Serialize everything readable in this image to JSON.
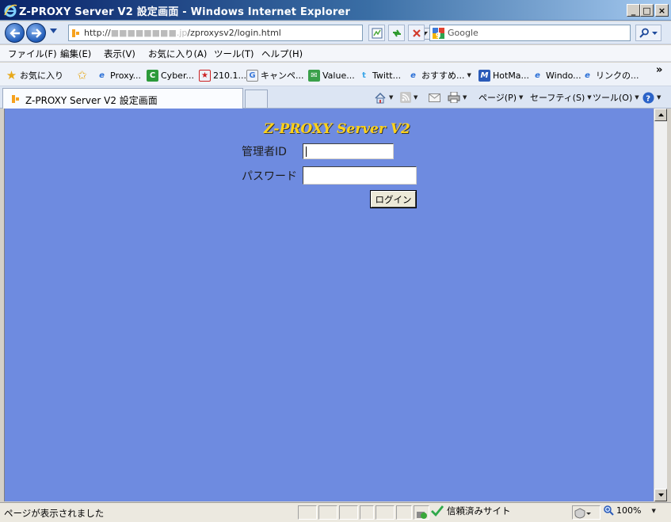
{
  "window": {
    "title": "Z-PROXY Server V2 設定画面 - Windows Internet Explorer",
    "controls": {
      "minimize": "_",
      "maximize": "□",
      "close": "×"
    }
  },
  "address_bar": {
    "url_prefix": "http://",
    "url_masked": "■■■■■■■■.jp",
    "url_path": "/zproxysv2/login.html"
  },
  "search": {
    "placeholder": "Google"
  },
  "menu": {
    "items": [
      "ファイル(F)",
      "編集(E)",
      "表示(V)",
      "お気に入り(A)",
      "ツール(T)",
      "ヘルプ(H)"
    ]
  },
  "favorites": {
    "label": "お気に入り",
    "items": [
      {
        "label": "Proxy..."
      },
      {
        "label": "Cyber..."
      },
      {
        "label": "210.1..."
      },
      {
        "label": "キャンペ..."
      },
      {
        "label": "Value..."
      },
      {
        "label": "Twitt..."
      },
      {
        "label": "おすすめ..."
      },
      {
        "label": "HotMa..."
      },
      {
        "label": "Windo..."
      },
      {
        "label": "リンクの..."
      }
    ],
    "more": "»"
  },
  "tab": {
    "label": "Z-PROXY Server V2 設定画面"
  },
  "command_bar": {
    "page": "ページ(P)",
    "safety": "セーフティ(S)",
    "tools": "ツール(O)"
  },
  "page": {
    "title": "Z-PROXY Server V2",
    "admin_id_label": "管理者ID",
    "admin_id_value": "",
    "password_label": "パスワード",
    "password_value": "",
    "login_button": "ログイン"
  },
  "status": {
    "text": "ページが表示されました",
    "zone": "信頼済みサイト",
    "zoom": "100%"
  },
  "colors": {
    "page_background": "#6e8be0",
    "title_text": "#ffd21a"
  }
}
